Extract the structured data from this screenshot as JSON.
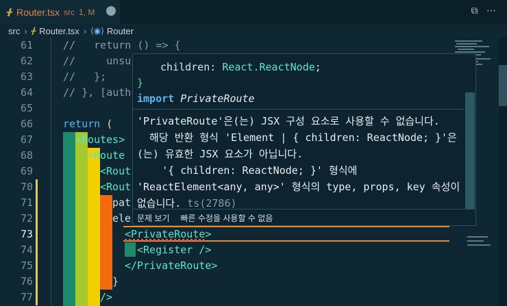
{
  "tab": {
    "icon": "typescript-icon",
    "filename": "Router.tsx",
    "dir": "src",
    "status": "1, M"
  },
  "tabbar_actions": "⧉ ⋯",
  "breadcrumb": {
    "folder": "src",
    "file": "Router.tsx",
    "symbol": "Router"
  },
  "lines": [
    {
      "num": "61",
      "text": "//   return () => {"
    },
    {
      "num": "62",
      "text": "//     unsu"
    },
    {
      "num": "63",
      "text": "//   };"
    },
    {
      "num": "64",
      "text": "// }, [auth"
    },
    {
      "num": "65",
      "text": ""
    },
    {
      "num": "66",
      "kw": "return",
      "punc": " ("
    },
    {
      "num": "67",
      "tag": "<Routes>"
    },
    {
      "num": "68",
      "tag": "<Route"
    },
    {
      "num": "69",
      "tag": "<Rout"
    },
    {
      "num": "70",
      "tag": "<Rout"
    },
    {
      "num": "71",
      "text": "pat"
    },
    {
      "num": "72",
      "text": "ele"
    },
    {
      "num": "73",
      "tag": "<PrivateRoute>"
    },
    {
      "num": "74",
      "tag": "<Register />"
    },
    {
      "num": "75",
      "tag": "</PrivateRoute>"
    },
    {
      "num": "76",
      "text": "}"
    },
    {
      "num": "77",
      "tag": "/>"
    }
  ],
  "popup": {
    "code_line1_prop": "children",
    "code_line1_colon": ": ",
    "code_line1_type": "React.ReactNode",
    "code_line1_end": ";",
    "code_line2": "}",
    "import_kw": "import",
    "import_name": "PrivateRoute",
    "message_lines": [
      "'PrivateRoute'은(는) JSX 구성 요소로 사용할 수 없습니다.",
      "  해당 반환 형식 'Element | { children: ReactNode; }'은",
      "(는) 유효한 JSX 요소가 아닙니다.",
      "    '{ children: ReactNode; }' 형식에",
      "'ReactElement<any, any>' 형식의 type, props, key 속성이",
      "없습니다."
    ],
    "error_code": "ts(2786)",
    "actions": {
      "view_problem": "문제 보기",
      "quick_fix": "빠른 수정을 사용할 수 없음"
    }
  },
  "colors": {
    "accent_error": "#f14c4c",
    "highlight": "#e88b28",
    "rainbow": [
      "#1e8a6a",
      "#a6c930",
      "#f2d000",
      "#f46a12"
    ]
  }
}
